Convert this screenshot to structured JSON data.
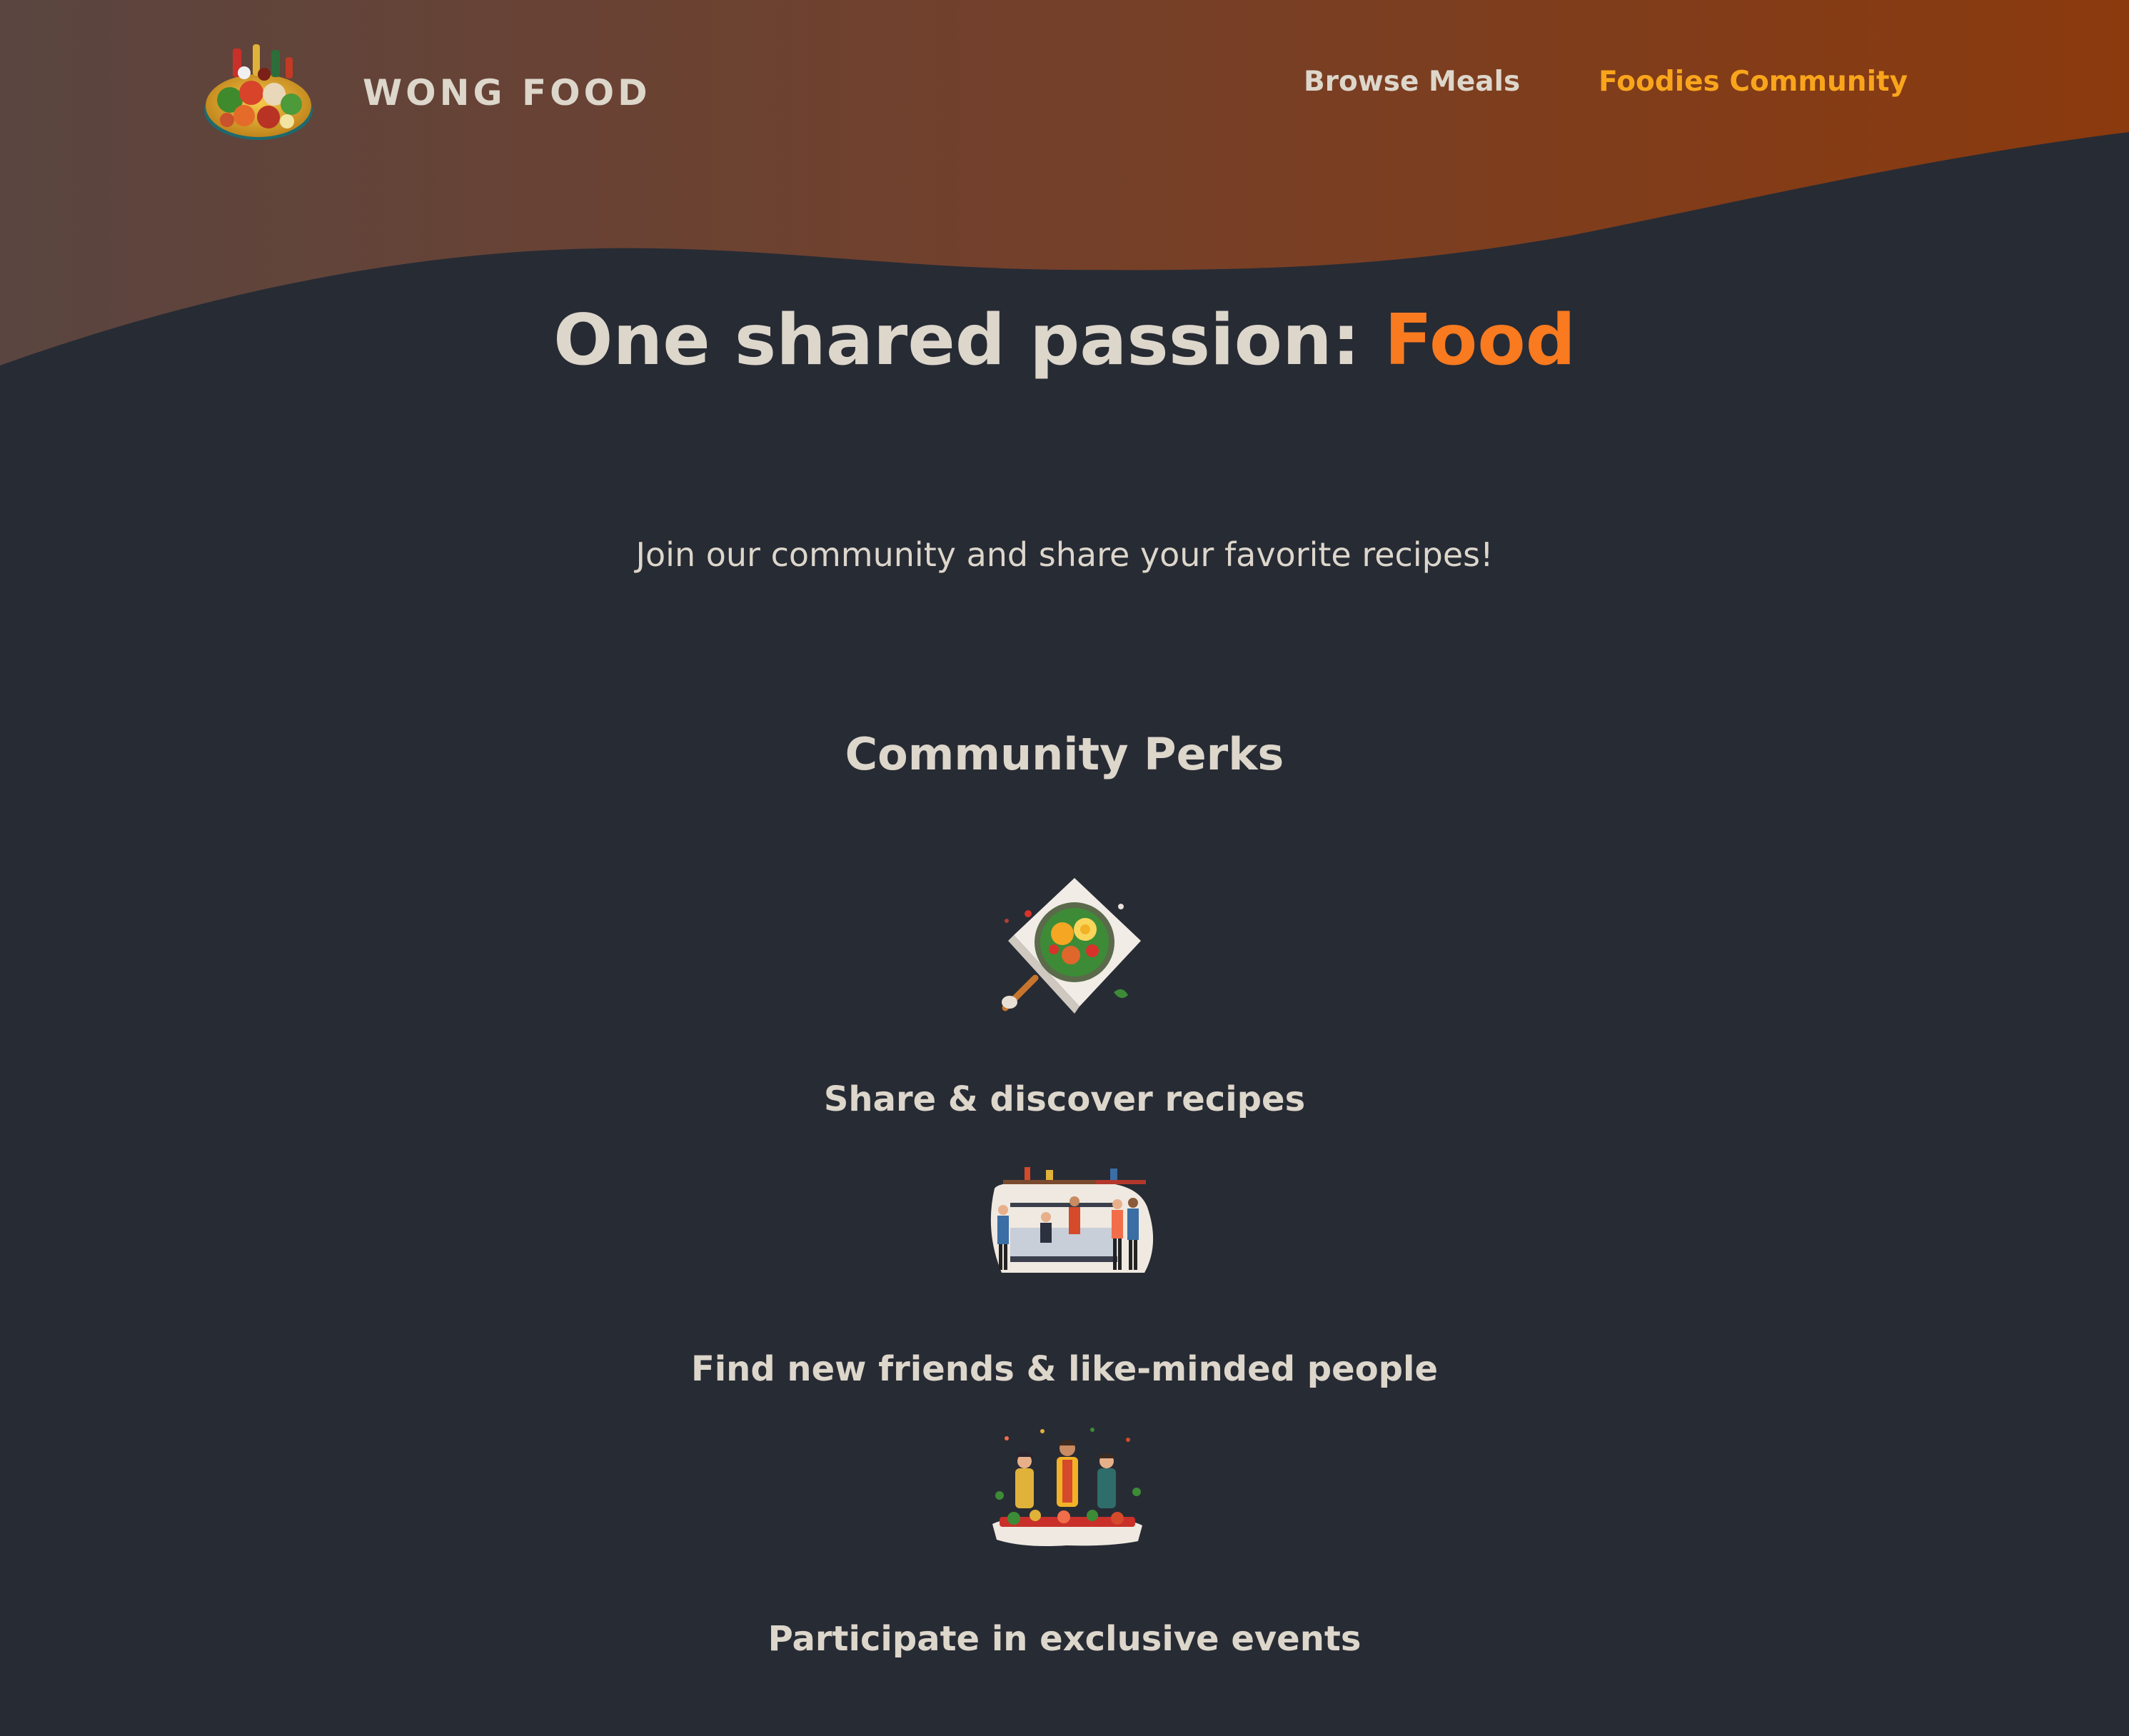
{
  "header": {
    "brand": "WONG FOOD",
    "nav": [
      {
        "label": "Browse Meals",
        "active": false
      },
      {
        "label": "Foodies Community",
        "active": true
      }
    ]
  },
  "hero": {
    "title_prefix": "One shared passion: ",
    "title_highlight": "Food",
    "subtitle": "Join our community and share your favorite recipes!"
  },
  "perks": {
    "heading": "Community Perks",
    "items": [
      {
        "title": "Share & discover recipes",
        "icon": "meal-plate-illustration"
      },
      {
        "title": "Find new friends & like-minded people",
        "icon": "kitchen-people-illustration"
      },
      {
        "title": "Participate in exclusive events",
        "icon": "cooking-event-illustration"
      }
    ]
  },
  "colors": {
    "background": "#272b34",
    "header_gradient_start": "#5a4540",
    "header_gradient_end": "#8b3a0d",
    "text": "#ddd6cb",
    "accent_orange": "#f97a1f",
    "nav_active": "#f9a51c"
  }
}
